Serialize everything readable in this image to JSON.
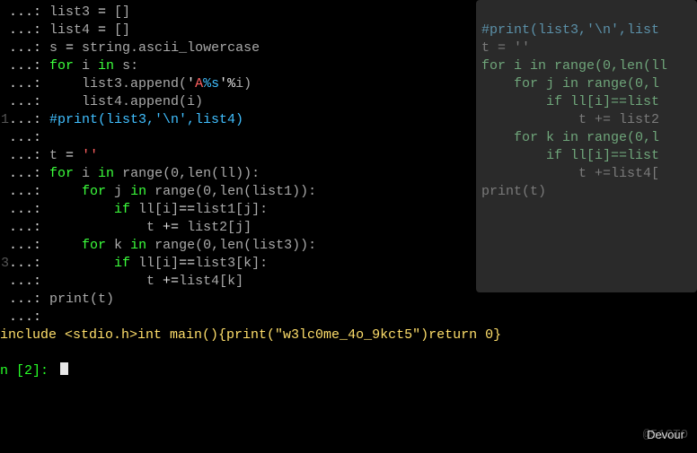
{
  "main": {
    "cont_prompt": "...: ",
    "lines": [
      {
        "gutter": "",
        "tokens": [
          {
            "t": "list3 ",
            "cls": ""
          },
          {
            "t": "=",
            "cls": "op"
          },
          {
            "t": " []",
            "cls": ""
          }
        ]
      },
      {
        "gutter": "",
        "tokens": [
          {
            "t": "list4 ",
            "cls": ""
          },
          {
            "t": "=",
            "cls": "op"
          },
          {
            "t": " []",
            "cls": ""
          }
        ]
      },
      {
        "gutter": "",
        "tokens": [
          {
            "t": "s ",
            "cls": ""
          },
          {
            "t": "=",
            "cls": "op"
          },
          {
            "t": " string.ascii_lowercase",
            "cls": ""
          }
        ]
      },
      {
        "gutter": "",
        "tokens": [
          {
            "t": "for",
            "cls": "kw"
          },
          {
            "t": " i ",
            "cls": ""
          },
          {
            "t": "in",
            "cls": "kw"
          },
          {
            "t": " s:",
            "cls": ""
          }
        ]
      },
      {
        "gutter": "",
        "tokens": [
          {
            "t": "    list3.append(",
            "cls": ""
          },
          {
            "t": "'",
            "cls": "str"
          },
          {
            "t": "A",
            "cls": "redlit"
          },
          {
            "t": "%s",
            "cls": "comment"
          },
          {
            "t": "'",
            "cls": "str"
          },
          {
            "t": "%",
            "cls": "op"
          },
          {
            "t": "i)",
            "cls": ""
          }
        ]
      },
      {
        "gutter": "",
        "tokens": [
          {
            "t": "    list4.append(i)",
            "cls": ""
          }
        ]
      },
      {
        "gutter": "1",
        "tokens": [
          {
            "t": "#print(list3,'\\n',list4)",
            "cls": "comment"
          }
        ]
      },
      {
        "gutter": "",
        "tokens": [
          {
            "t": "",
            "cls": ""
          }
        ]
      },
      {
        "gutter": "",
        "tokens": [
          {
            "t": "t ",
            "cls": ""
          },
          {
            "t": "=",
            "cls": "op"
          },
          {
            "t": " ",
            "cls": ""
          },
          {
            "t": "''",
            "cls": "redlit"
          }
        ]
      },
      {
        "gutter": "",
        "tokens": [
          {
            "t": "for",
            "cls": "kw"
          },
          {
            "t": " i ",
            "cls": ""
          },
          {
            "t": "in",
            "cls": "kw"
          },
          {
            "t": " range(",
            "cls": ""
          },
          {
            "t": "0",
            "cls": ""
          },
          {
            "t": ",len(ll)):",
            "cls": ""
          }
        ]
      },
      {
        "gutter": "",
        "tokens": [
          {
            "t": "    ",
            "cls": ""
          },
          {
            "t": "for",
            "cls": "kw"
          },
          {
            "t": " j ",
            "cls": ""
          },
          {
            "t": "in",
            "cls": "kw"
          },
          {
            "t": " range(",
            "cls": ""
          },
          {
            "t": "0",
            "cls": ""
          },
          {
            "t": ",len(list1)):",
            "cls": ""
          }
        ]
      },
      {
        "gutter": "",
        "tokens": [
          {
            "t": "        ",
            "cls": ""
          },
          {
            "t": "if",
            "cls": "kw"
          },
          {
            "t": " ll[i]",
            "cls": ""
          },
          {
            "t": "==",
            "cls": "op"
          },
          {
            "t": "list1[j]:",
            "cls": ""
          }
        ]
      },
      {
        "gutter": "",
        "tokens": [
          {
            "t": "            t ",
            "cls": ""
          },
          {
            "t": "+=",
            "cls": "op"
          },
          {
            "t": " list2[j]",
            "cls": ""
          }
        ]
      },
      {
        "gutter": "",
        "tokens": [
          {
            "t": "    ",
            "cls": ""
          },
          {
            "t": "for",
            "cls": "kw"
          },
          {
            "t": " k ",
            "cls": ""
          },
          {
            "t": "in",
            "cls": "kw"
          },
          {
            "t": " range(",
            "cls": ""
          },
          {
            "t": "0",
            "cls": ""
          },
          {
            "t": ",len(list3)):",
            "cls": ""
          }
        ]
      },
      {
        "gutter": "3",
        "tokens": [
          {
            "t": "        ",
            "cls": ""
          },
          {
            "t": "if",
            "cls": "kw"
          },
          {
            "t": " ll[i]",
            "cls": ""
          },
          {
            "t": "==",
            "cls": "op"
          },
          {
            "t": "list3[k]:",
            "cls": ""
          }
        ]
      },
      {
        "gutter": "",
        "tokens": [
          {
            "t": "            t ",
            "cls": ""
          },
          {
            "t": "+=",
            "cls": "op"
          },
          {
            "t": "list4[k]",
            "cls": ""
          }
        ]
      },
      {
        "gutter": "",
        "tokens": [
          {
            "t": "print(t)",
            "cls": ""
          }
        ]
      },
      {
        "gutter": "",
        "tokens": [
          {
            "t": "",
            "cls": ""
          }
        ]
      }
    ],
    "result": "include <stdio.h>int main(){print(\"w3lc0me_4o_9kct5\")return 0}",
    "in_prompt": "n [2]: "
  },
  "overlay": {
    "lines": [
      {
        "cls": "ocomment",
        "t": "#print(list3,'\\n',list"
      },
      {
        "cls": "",
        "t": ""
      },
      {
        "cls": "",
        "t": "t = ''"
      },
      {
        "cls": "ok",
        "t": "for i in range(0,len(ll"
      },
      {
        "cls": "ok",
        "t": "    for j in range(0,l"
      },
      {
        "cls": "ok",
        "t": "        if ll[i]==list"
      },
      {
        "cls": "",
        "t": "            t += list2"
      },
      {
        "cls": "ok",
        "t": "    for k in range(0,l"
      },
      {
        "cls": "ok",
        "t": "        if ll[i]==list"
      },
      {
        "cls": "",
        "t": "            t +=list4["
      },
      {
        "cls": "",
        "t": "print(t)"
      }
    ]
  },
  "watermark": "@51CTO",
  "devour": "Devour"
}
